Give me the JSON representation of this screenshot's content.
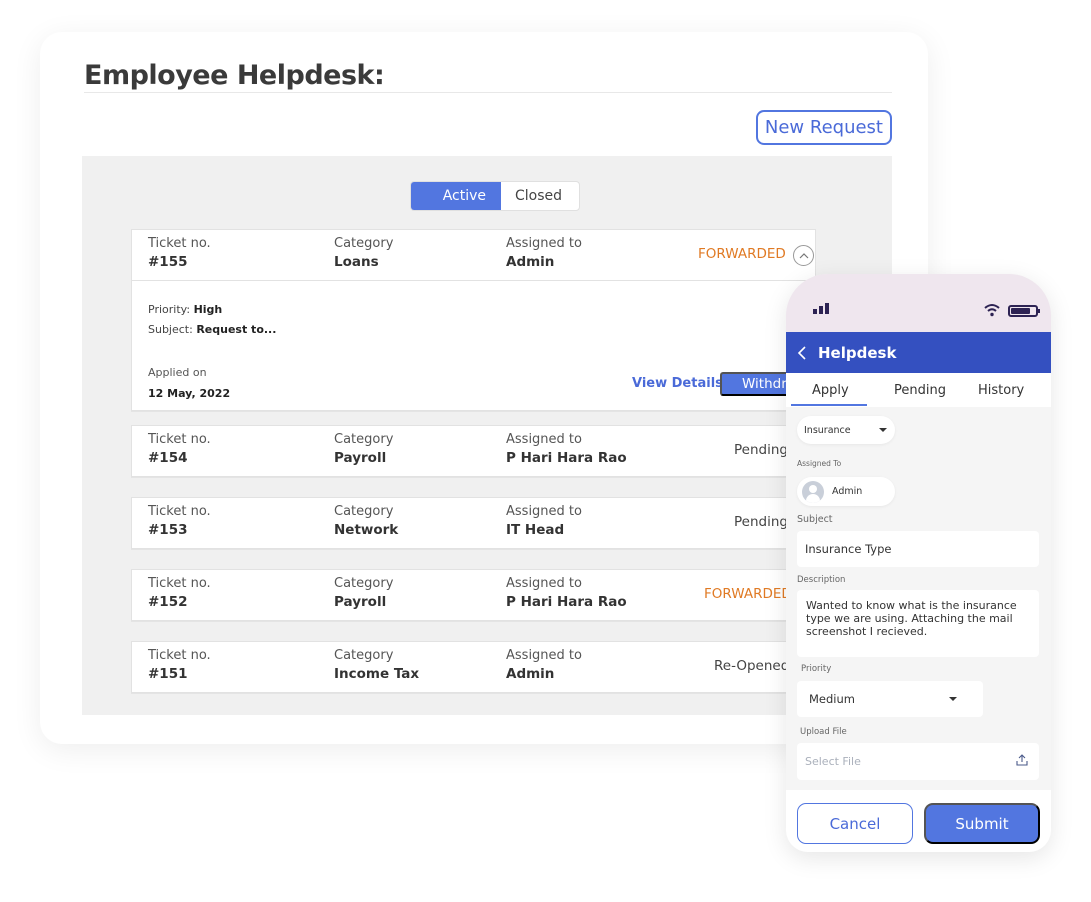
{
  "page": {
    "title": "Employee Helpdesk:",
    "new_request_label": "New Request"
  },
  "filter_toggle": {
    "options": [
      "Active",
      "Closed"
    ],
    "selected": "Active"
  },
  "tickets": [
    {
      "ticket_label": "Ticket no.",
      "ticket_no": "#155",
      "category_label": "Category",
      "category": "Loans",
      "assigned_label": "Assigned to",
      "assigned_to": "Admin",
      "status": "FORWARDED",
      "expanded": true,
      "details": {
        "priority_label": "Priority:",
        "priority": "High",
        "subject_label": "Subject:",
        "subject": "Request to...",
        "applied_label": "Applied on",
        "applied_on": "12 May, 2022",
        "view_details_label": "View Details",
        "withdraw_label": "Withdraw"
      }
    },
    {
      "ticket_label": "Ticket no.",
      "ticket_no": "#154",
      "category_label": "Category",
      "category": "Payroll",
      "assigned_label": "Assigned to",
      "assigned_to": "P Hari Hara Rao",
      "status": "Pending"
    },
    {
      "ticket_label": "Ticket no.",
      "ticket_no": "#153",
      "category_label": "Category",
      "category": "Network",
      "assigned_label": "Assigned to",
      "assigned_to": "IT Head",
      "status": "Pending"
    },
    {
      "ticket_label": "Ticket no.",
      "ticket_no": "#152",
      "category_label": "Category",
      "category": "Payroll",
      "assigned_label": "Assigned to",
      "assigned_to": "P Hari Hara Rao",
      "status": "FORWARDED"
    },
    {
      "ticket_label": "Ticket no.",
      "ticket_no": "#151",
      "category_label": "Category",
      "category": "Income Tax",
      "assigned_label": "Assigned to",
      "assigned_to": "Admin",
      "status": "Re-Opened"
    }
  ],
  "colors": {
    "accent": "#5276e0",
    "header_blue": "#3450c0",
    "forwarded": "#e07a24",
    "content_bg": "#f0f0f0"
  },
  "mobile": {
    "header_title": "Helpdesk",
    "tabs": [
      "Apply",
      "Pending",
      "History"
    ],
    "selected_tab": "Apply",
    "category_select": "Insurance",
    "assigned_to_label": "Assigned To",
    "assigned_to": "Admin",
    "subject_label": "Subject",
    "subject_value": "Insurance Type",
    "description_label": "Description",
    "description_value": "Wanted to know what is the insurance type we are using. Attaching the mail screenshot I recieved.",
    "priority_label": "Priority",
    "priority_value": "Medium",
    "upload_label": "Upload File",
    "upload_placeholder": "Select File",
    "cancel_label": "Cancel",
    "submit_label": "Submit"
  }
}
